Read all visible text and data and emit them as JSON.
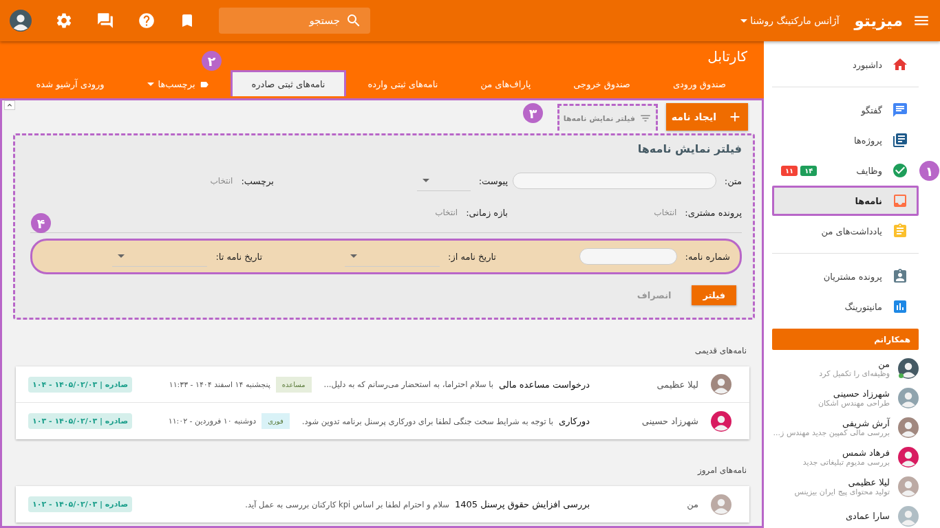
{
  "topbar": {
    "logo": "میزیتو",
    "org": "آژانس مارکتینگ روشنا",
    "search": {
      "placeholder": "جستجو"
    }
  },
  "sidebar": {
    "sections": [
      {
        "items": [
          {
            "label": "داشبورد",
            "selected": false
          }
        ]
      },
      {
        "items": [
          {
            "label": "گفتگو",
            "selected": false
          },
          {
            "label": "پروژه‌ها",
            "selected": false
          },
          {
            "label": "وظایف",
            "selected": false,
            "badges": [
              {
                "text": "۱۴",
                "color": "#1e9e5a"
              },
              {
                "text": "۱۱",
                "color": "#f44336"
              }
            ]
          },
          {
            "label": "نامه‌ها",
            "selected": true
          },
          {
            "label": "یادداشت‌های من",
            "selected": false
          }
        ]
      },
      {
        "items": [
          {
            "label": "پرونده مشتریان",
            "selected": false
          },
          {
            "label": "مانیتورینگ",
            "selected": false
          }
        ]
      }
    ],
    "colleagues_title": "همکارانم",
    "colleagues": [
      {
        "name": "من",
        "status": "وظیفه‌ای را تکمیل کرد",
        "online": true
      },
      {
        "name": "شهرزاد حسینی",
        "status": "طراحی مهندس اشکان",
        "online": false
      },
      {
        "name": "آرش شریفی",
        "status": "بررسی مالی کمپین جدید مهندس ز...",
        "online": false
      },
      {
        "name": "فرهاد شمس",
        "status": "بررسی مدیوم تبلیغاتی جدید",
        "online": false
      },
      {
        "name": "لیلا عظیمی",
        "status": "تولید محتوای پیج ایران بیزینس",
        "online": false
      },
      {
        "name": "سارا عمادی",
        "online": false
      }
    ]
  },
  "page": {
    "title": "کارتابل",
    "tabs": [
      {
        "label": "صندوق ورودی",
        "selected": false,
        "kind": "tab"
      },
      {
        "label": "صندوق خروجی",
        "selected": false,
        "kind": "tab"
      },
      {
        "label": "پاراف‌های من",
        "selected": false,
        "kind": "tab"
      },
      {
        "label": "نامه‌های ثبتی وارده",
        "selected": false,
        "kind": "tab"
      },
      {
        "label": "نامه‌های ثبتی صادره",
        "selected": true,
        "kind": "tab"
      },
      {
        "label": "برچسب‌ها",
        "selected": false,
        "kind": "dropdown"
      },
      {
        "label": "ورودی آرشیو شده",
        "selected": false,
        "kind": "tab"
      }
    ]
  },
  "toolbar": {
    "create_button": "ایجاد نامه",
    "filter_toggle": "فیلتر نمایش نامه‌ها"
  },
  "filter": {
    "title": "فیلتر نمایش نامه‌ها",
    "rows": [
      {
        "highlighted": false,
        "fields": [
          {
            "label": "متن:",
            "kind": "text"
          },
          {
            "label": "پیوست:",
            "kind": "select"
          },
          {
            "label": "برچسب:",
            "kind": "picker",
            "value": "انتخاب"
          }
        ]
      },
      {
        "highlighted": false,
        "fields": [
          {
            "label": "پرونده مشتری:",
            "kind": "picker",
            "value": "انتخاب"
          },
          {
            "label": "بازه زمانی:",
            "kind": "picker",
            "value": "انتخاب"
          }
        ]
      },
      {
        "highlighted": true,
        "fields": [
          {
            "label": "شماره نامه:",
            "kind": "text"
          },
          {
            "label": "تاریخ نامه از:",
            "kind": "select"
          },
          {
            "label": "تاریخ نامه تا:",
            "kind": "select"
          }
        ]
      }
    ],
    "apply_button": "فیلتر",
    "cancel_button": "انصراف"
  },
  "groups": [
    {
      "title": "نامه‌های قدیمی",
      "letters": [
        {
          "sender": "لیلا عظیمی",
          "subject": "درخواست مساعده مالی",
          "snippet": "با سلام احتراما، به استحضار می‌رسانم که به دلیل...",
          "tag": {
            "text": "مساعده",
            "color": "#e6eedc"
          },
          "date": "پنجشنبه ۱۴ اسفند ۱۴۰۴ - ۱۱:۳۳",
          "ref": "صادره | ۱۴۰۵/۰۲/۰۳ - ۱۰۴"
        },
        {
          "sender": "شهرزاد حسینی",
          "subject": "دورکاری",
          "snippet": "با توجه به شرایط سخت جنگی لطفا برای دورکاری پرسنل برنامه تدوین شود.",
          "tag": {
            "text": "فوری",
            "color": "#d9f2f7"
          },
          "date": "دوشنبه ۱۰ فروردین - ۱۱:۰۲",
          "ref": "صادره | ۱۴۰۵/۰۲/۰۳ - ۱۰۳"
        }
      ]
    },
    {
      "title": "نامه‌های امروز",
      "letters": [
        {
          "sender": "من",
          "subject": "بررسی افزایش حقوق پرسنل 1405",
          "snippet": "سلام و احترام لطفا بر اساس kpi کارکنان بررسی به عمل آید.",
          "ref": "صادره | ۱۴۰۵/۰۲/۰۳ - ۱۰۲"
        }
      ]
    }
  ],
  "annotations": [
    {
      "number": "۱"
    },
    {
      "number": "۲"
    },
    {
      "number": "۳"
    },
    {
      "number": "۴"
    }
  ]
}
